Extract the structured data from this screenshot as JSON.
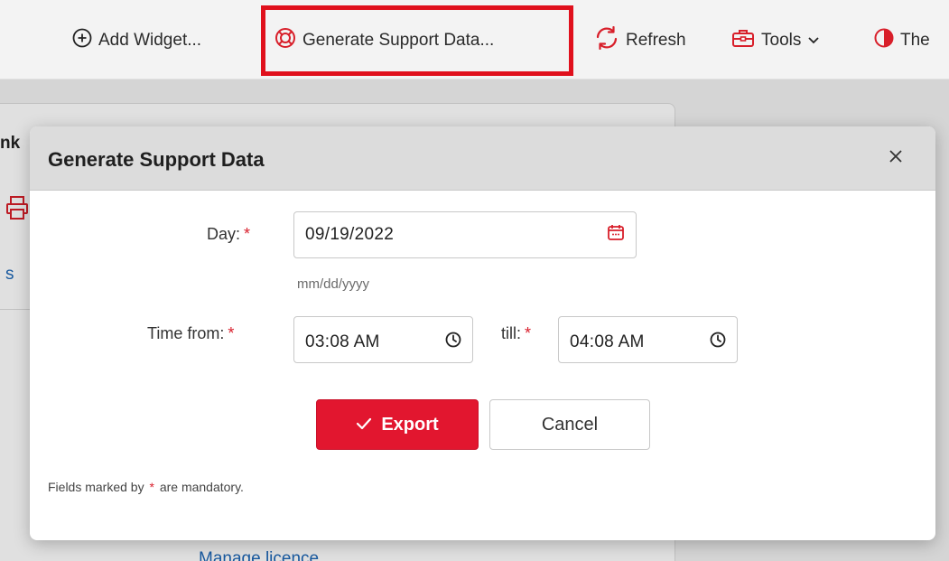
{
  "toolbar": {
    "add_widget": "Add Widget...",
    "generate_support_data": "Generate Support Data...",
    "refresh": "Refresh",
    "tools": "Tools",
    "theme": "The"
  },
  "background": {
    "card_title_fragment": "nk",
    "link_fragment": "s",
    "manage_licence": "Manage licence"
  },
  "dialog": {
    "title": "Generate Support Data",
    "close_symbol": "×",
    "day_label": "Day:",
    "required_marker": "*",
    "day_value": "09/19/2022",
    "day_hint": "mm/dd/yyyy",
    "time_from_label": "Time from:",
    "time_from_value": "03:08 AM",
    "till_label": "till:",
    "till_value": "04:08 AM",
    "export_label": "Export",
    "cancel_label": "Cancel",
    "footnote_prefix": "Fields marked by",
    "footnote_suffix": "are mandatory."
  },
  "colors": {
    "accent": "#e2162f",
    "highlight": "#e0101c",
    "link": "#1c66b5"
  }
}
